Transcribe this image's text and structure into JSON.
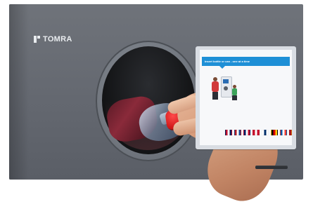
{
  "brand": {
    "logo_text": "TOMRA"
  },
  "screen": {
    "header_label": "",
    "prompt_text": "Insert bottle or can - one at a time",
    "illustration_icons": [
      "person-icon",
      "reverse-vending-machine-icon",
      "child-icon"
    ],
    "languages": [
      "Norway",
      "Netherlands",
      "United Kingdom",
      "Denmark",
      "Finland",
      "Germany",
      "France",
      "Spain"
    ],
    "flag_colors": [
      [
        "#ba0c2f",
        "#ffffff",
        "#00205b"
      ],
      [
        "#ae1c28",
        "#ffffff",
        "#21468b"
      ],
      [
        "#012169",
        "#ffffff",
        "#c8102e"
      ],
      [
        "#c8102e",
        "#ffffff",
        "#c8102e"
      ],
      [
        "#ffffff",
        "#002f6c",
        "#ffffff"
      ],
      [
        "#000000",
        "#dd0000",
        "#ffce00"
      ],
      [
        "#0055a4",
        "#ffffff",
        "#ef4135"
      ],
      [
        "#aa151b",
        "#f1bf00",
        "#aa151b"
      ]
    ]
  },
  "colors": {
    "machine_body": "#666a72",
    "accent_blue": "#1e8fd6",
    "cap_red": "#d21b1b"
  }
}
